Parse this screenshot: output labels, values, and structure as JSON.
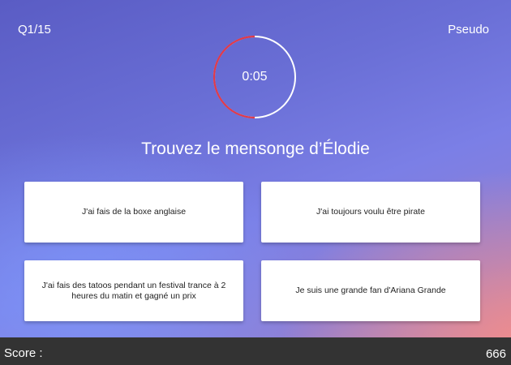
{
  "header": {
    "question_counter": "Q1/15",
    "pseudo": "Pseudo"
  },
  "timer": {
    "time": "0:05",
    "remaining_fraction": 0.5,
    "ring_color": "#ffffff",
    "elapsed_color": "#e03a4a"
  },
  "question": {
    "text": "Trouvez le mensonge d’Élodie"
  },
  "answers": [
    {
      "text": "J'ai fais de la boxe anglaise"
    },
    {
      "text": "J'ai toujours voulu être pirate"
    },
    {
      "text": "J'ai fais des tatoos pendant un festival trance à 2 heures du matin et gagné un prix"
    },
    {
      "text": "Je suis une grande fan d'Ariana Grande"
    }
  ],
  "footer": {
    "score_label": "Score :",
    "score_value": "666"
  }
}
